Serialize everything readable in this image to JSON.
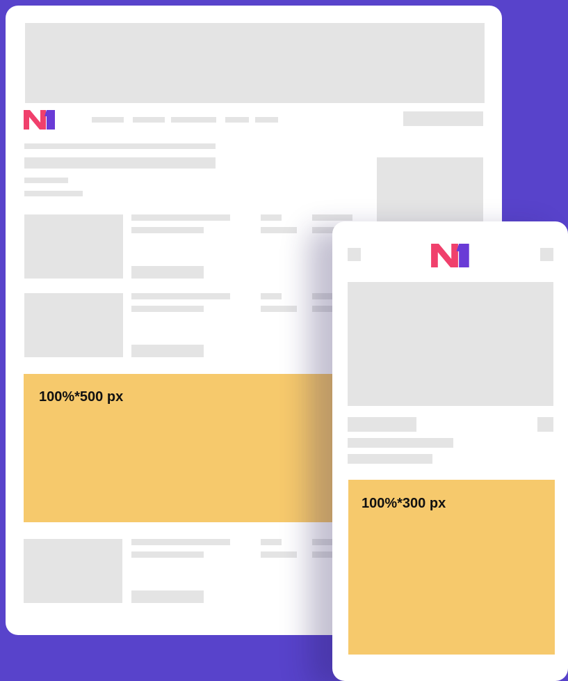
{
  "brand": {
    "logo_text": "N1",
    "primary_color": "#f0406c",
    "secondary_color": "#6a3bd6"
  },
  "desktop": {
    "ad_banner_label": "100%*500 px"
  },
  "mobile": {
    "ad_banner_label": "100%*300 px"
  },
  "colors": {
    "background": "#5843cb",
    "card": "#ffffff",
    "placeholder": "#e4e4e4",
    "ad_banner": "#f6c96c"
  }
}
